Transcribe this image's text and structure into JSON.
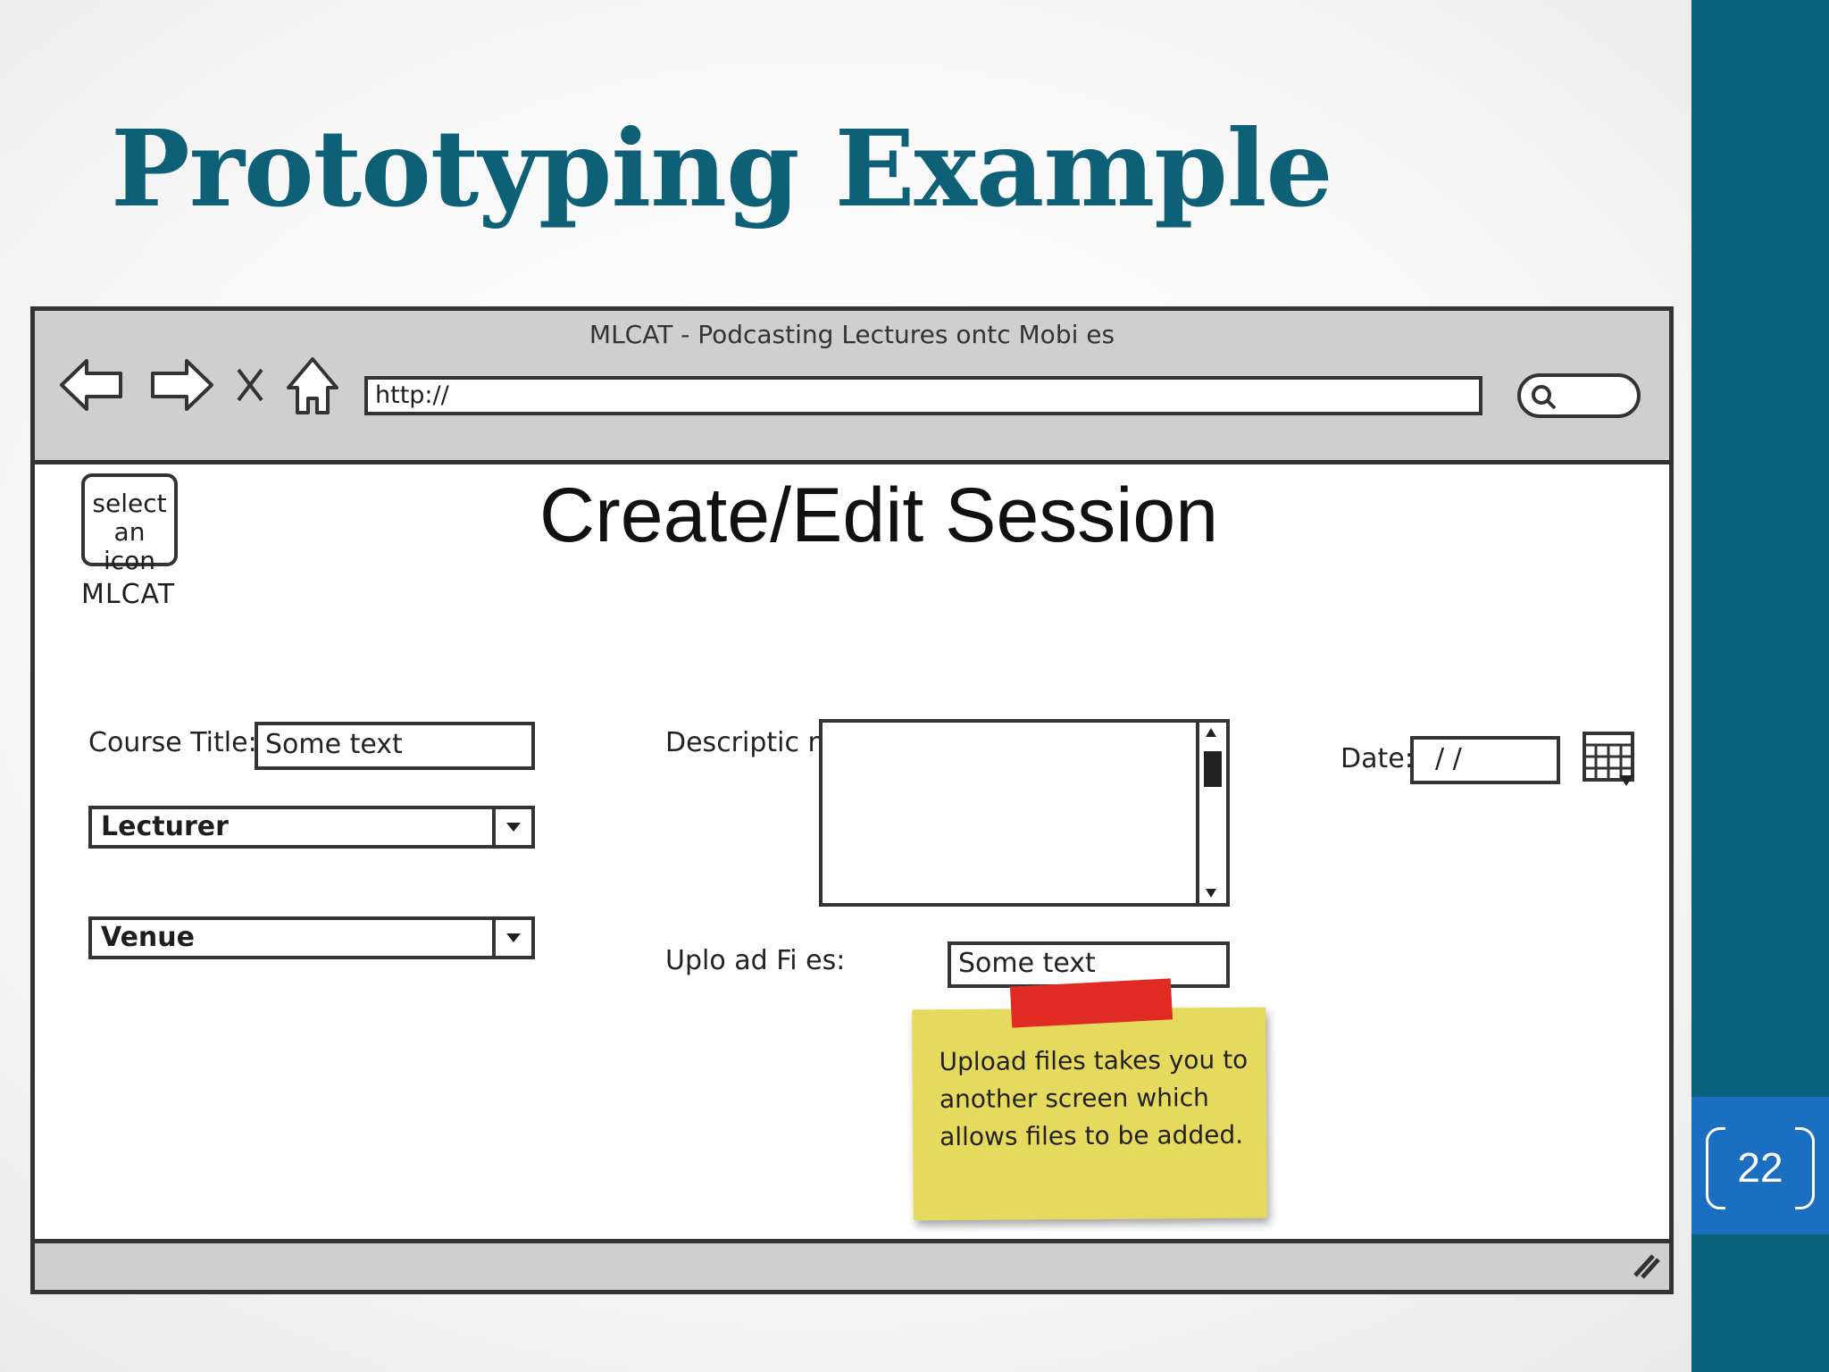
{
  "slide": {
    "title": "Prototyping Example",
    "page_number": "22",
    "accent_color": "#09607a"
  },
  "mockup": {
    "window_title": "MLCAT - Podcasting Lectures ontc Mobi es",
    "nav_icons": [
      "back-arrow-icon",
      "forward-arrow-icon",
      "close-icon",
      "home-icon"
    ],
    "url_value": "http://",
    "logo_text": "select an icon",
    "logo_caption": "MLCAT",
    "page_heading": "Create/Edit Session",
    "course_title_label": "Course Title:",
    "course_title_value": "Some text",
    "lecturer_select": "Lecturer",
    "venue_select": "Venue",
    "description_label": "Descriptic n:",
    "upload_label": "Uplo ad Fi es:",
    "upload_value": "Some text",
    "date_label": "Date:",
    "date_value": "/ /",
    "note_text": "Upload files takes you to another screen which allows files to be added."
  }
}
